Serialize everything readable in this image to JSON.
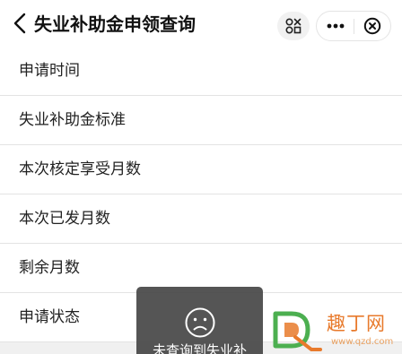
{
  "header": {
    "title": "失业补助金申领查询"
  },
  "list": {
    "items": [
      {
        "label": "申请时间"
      },
      {
        "label": "失业补助金标准"
      },
      {
        "label": "本次核定享受月数"
      },
      {
        "label": "本次已发月数"
      },
      {
        "label": "剩余月数"
      },
      {
        "label": "申请状态"
      }
    ]
  },
  "toast": {
    "message": "未查询到失业补",
    "icon": "sad-face-icon"
  },
  "watermark": {
    "site_name": "趣丁网",
    "url": "www.qzd.com"
  },
  "colors": {
    "background": "#ffffff",
    "divider": "#e3e3e3",
    "toast_bg": "#464646",
    "watermark_orange": "#e87a2c",
    "watermark_green": "#4caf50"
  }
}
